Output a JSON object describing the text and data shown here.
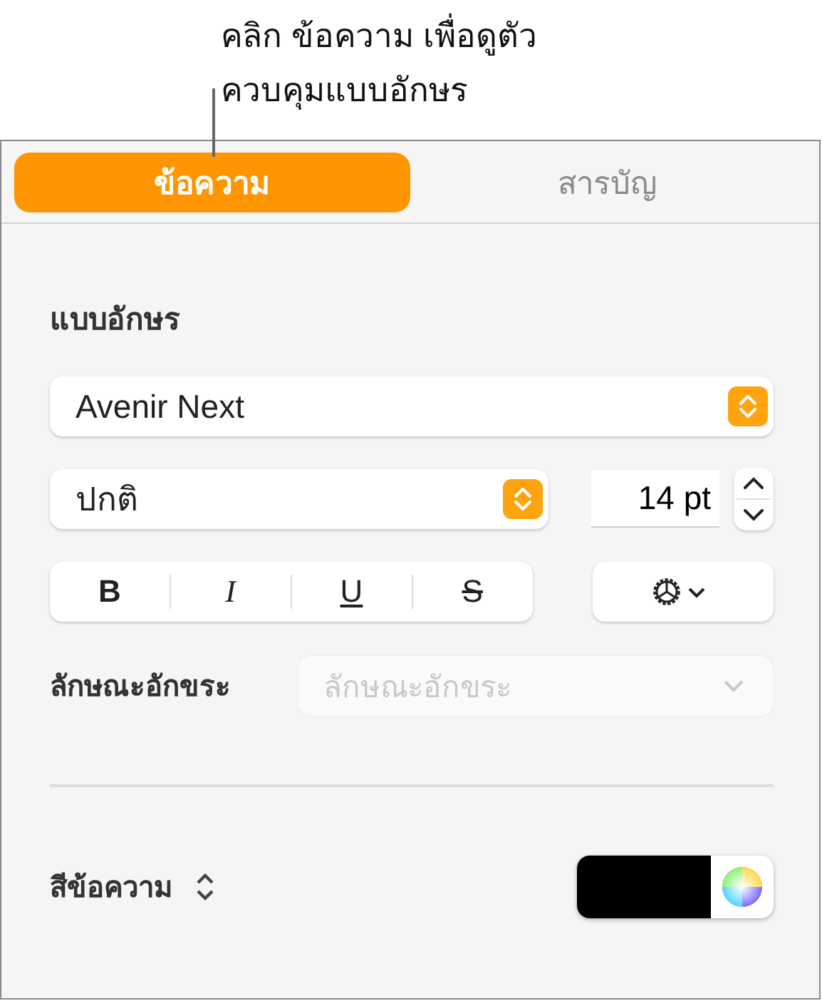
{
  "callout": {
    "lines": [
      "คลิก ข้อความ เพื่อดูตัว",
      "ควบคุมแบบอักษร"
    ]
  },
  "tabs": [
    {
      "label": "ข้อความ",
      "selected": true
    },
    {
      "label": "สารบัญ",
      "selected": false
    }
  ],
  "font_section": {
    "heading": "แบบอักษร",
    "font_family": "Avenir Next",
    "typeface": "ปกติ",
    "size": "14 pt"
  },
  "format_buttons": [
    {
      "label": "B",
      "kind": "bold"
    },
    {
      "label": "I",
      "kind": "italic"
    },
    {
      "label": "U",
      "kind": "underline"
    },
    {
      "label": "S",
      "kind": "strike"
    }
  ],
  "character_style": {
    "label": "ลักษณะอักขระ",
    "value": "ลักษณะอักขระ",
    "disabled": true
  },
  "text_color": {
    "label": "สีข้อความ",
    "color": "#000000"
  }
}
